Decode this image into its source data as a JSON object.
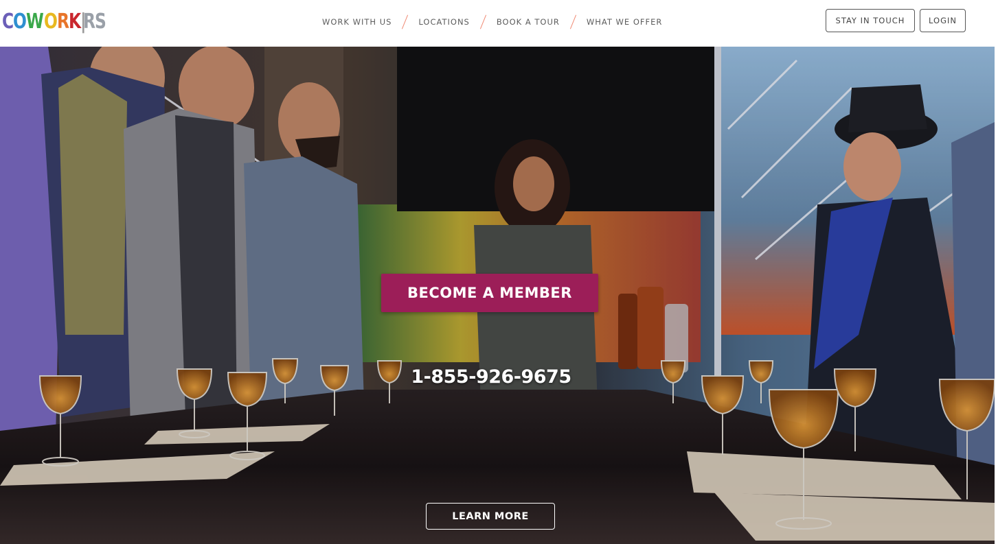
{
  "brand": {
    "logo_letters": [
      {
        "char": "C",
        "color": "#6b5fb8"
      },
      {
        "char": "O",
        "color": "#2f8fd0"
      },
      {
        "char": "W",
        "color": "#3aa84a"
      },
      {
        "char": "O",
        "color": "#e8b820"
      },
      {
        "char": "R",
        "color": "#e8752a"
      },
      {
        "char": "K",
        "color": "#c9262d"
      },
      {
        "char": "|",
        "color": "#9a9a9a"
      },
      {
        "char": "R",
        "color": "#9aa0a8"
      },
      {
        "char": "S",
        "color": "#9aa0a8"
      }
    ]
  },
  "nav": {
    "items": [
      "WORK WITH US",
      "LOCATIONS",
      "BOOK A TOUR",
      "WHAT WE OFFER"
    ],
    "separator_color": "#f08a73"
  },
  "header_buttons": {
    "stay_in_touch": "STAY IN TOUCH",
    "login": "LOGIN"
  },
  "hero": {
    "cta_label": "BECOME A MEMBER",
    "cta_color": "#9c1e58",
    "phone": "1-855-926-9675",
    "learn_more": "LEARN MORE"
  }
}
